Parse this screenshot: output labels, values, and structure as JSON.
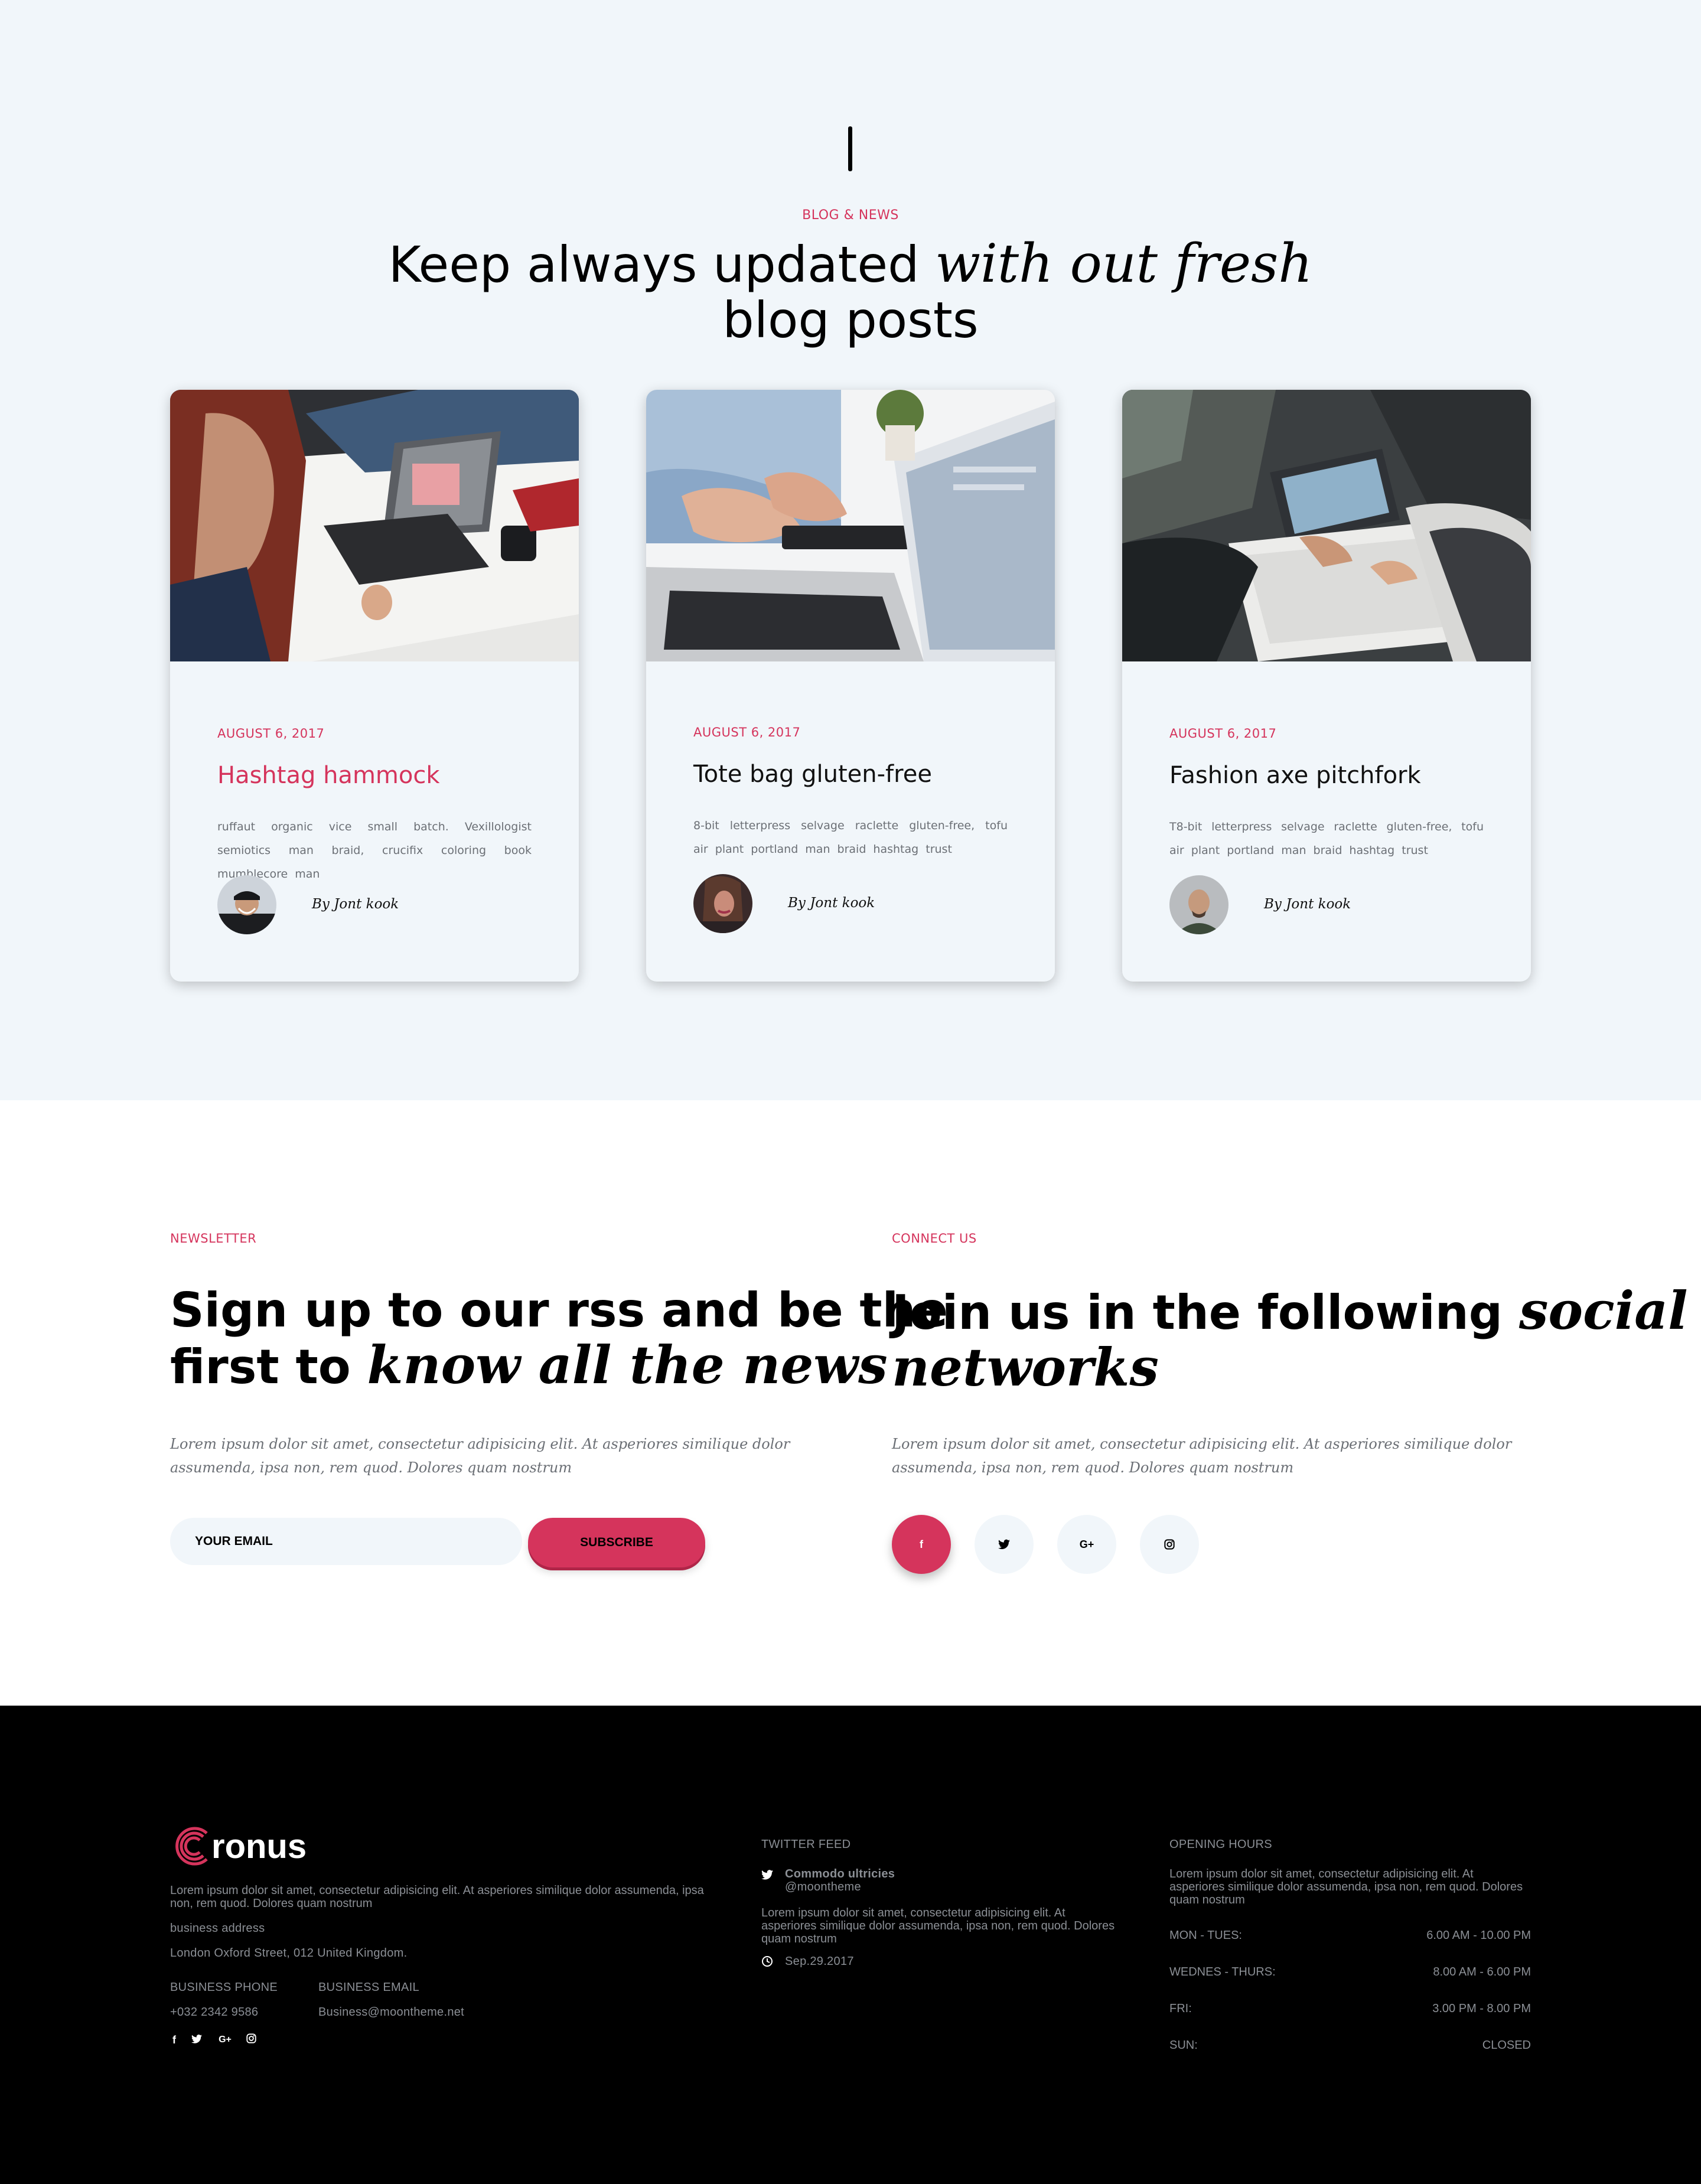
{
  "blog": {
    "kicker": "BLOG & NEWS",
    "headline_plain": "Keep always updated",
    "headline_italic": "with out fresh",
    "headline_line2": "blog posts",
    "posts": [
      {
        "date": "AUGUST 6, 2017",
        "title": "Hashtag hammock",
        "excerpt": "ruffaut organic vice small batch. Vexillologist semiotics man braid, crucifix coloring book mumblecore man",
        "author": "By Jont kook",
        "title_color": "#d5345c"
      },
      {
        "date": "AUGUST 6, 2017",
        "title": "Tote bag gluten-free",
        "excerpt": "8-bit letterpress selvage raclette gluten-free, tofu air plant portland man braid hashtag trust",
        "author": "By Jont kook",
        "title_color": "#111111"
      },
      {
        "date": "AUGUST 6, 2017",
        "title": "Fashion axe pitchfork",
        "excerpt": "T8-bit letterpress selvage raclette gluten-free, tofu air plant portland man braid hashtag trust",
        "author": "By Jont kook",
        "title_color": "#111111"
      }
    ]
  },
  "newsletter": {
    "kicker": "NEWSLETTER",
    "heading_line1": "Sign up to our rss and be the",
    "heading_line2_plain": "first to",
    "heading_line2_italic": "know all the news",
    "paragraph": "Lorem ipsum dolor sit amet, consectetur adipisicing elit. At asperiores similique dolor assumenda, ipsa non, rem quod. Dolores quam nostrum",
    "email_placeholder": "YOUR EMAIL",
    "subscribe_label": "SUBSCRIBE"
  },
  "connect": {
    "kicker": "CONNECT US",
    "heading_plain": "Join us in the following",
    "heading_italic_1": "social",
    "heading_italic_2": "networks",
    "paragraph": "Lorem ipsum dolor sit amet, consectetur adipisicing elit. At asperiores similique dolor assumenda, ipsa non, rem quod. Dolores quam nostrum",
    "networks": [
      {
        "icon": "facebook-icon",
        "glyph": "f"
      },
      {
        "icon": "twitter-icon",
        "glyph": "t"
      },
      {
        "icon": "google-plus-icon",
        "glyph": "G+"
      },
      {
        "icon": "instagram-icon",
        "glyph": "◎"
      }
    ]
  },
  "footer": {
    "brand": "ronus",
    "about": "Lorem ipsum dolor sit amet, consectetur adipisicing elit. At asperiores similique dolor assumenda, ipsa non, rem quod. Dolores quam nostrum",
    "address_label": "business address",
    "address": "London Oxford Street, 012 United Kingdom.",
    "phone_label": "BUSINESS PHONE",
    "phone": "+032 2342 9586",
    "email_label": "BUSINESS EMAIL",
    "email": "Business@moontheme.net",
    "twitter": {
      "title": "TWITTER FEED",
      "name": "Commodo ultricies",
      "handle": "@moontheme",
      "text": "Lorem ipsum dolor sit amet, consectetur adipisicing elit. At asperiores similique dolor assumenda, ipsa non, rem quod. Dolores quam nostrum",
      "date": "Sep.29.2017"
    },
    "hours": {
      "title": "OPENING HOURS",
      "text": "Lorem ipsum dolor sit amet, consectetur adipisicing elit. At asperiores similique dolor assumenda, ipsa non, rem quod. Dolores quam nostrum",
      "rows": [
        {
          "day": "MON - TUES:",
          "time": "6.00 AM - 10.00 PM"
        },
        {
          "day": "WEDNES - THURS:",
          "time": "8.00 AM - 6.00 PM"
        },
        {
          "day": "FRI:",
          "time": "3.00 PM - 8.00 PM"
        },
        {
          "day": "SUN:",
          "time": "CLOSED"
        }
      ]
    }
  },
  "colors": {
    "accent": "#d5345c",
    "section_bg": "#f1f6fa",
    "footer_bg": "#000000"
  }
}
